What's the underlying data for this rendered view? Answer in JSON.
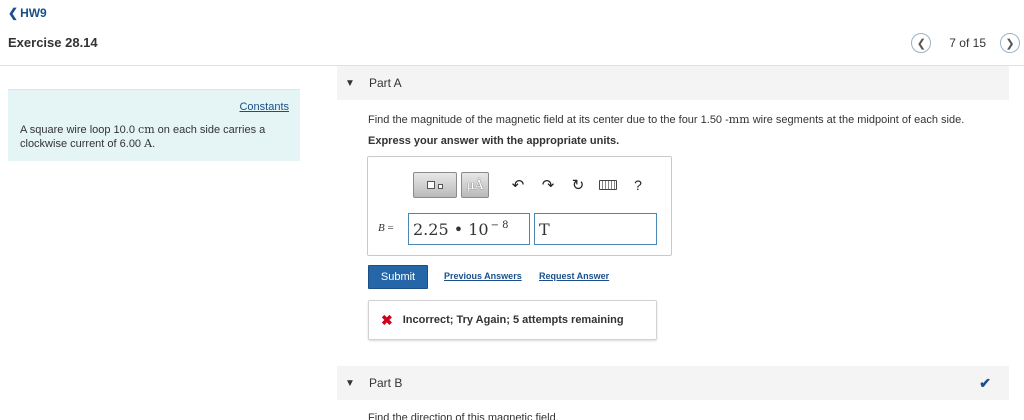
{
  "nav": {
    "back_label": "HW9"
  },
  "exercise": {
    "title": "Exercise 28.14"
  },
  "pager": {
    "text": "7 of 15"
  },
  "problem": {
    "constants_link": "Constants",
    "line1_prefix": "A square wire loop 10.0 ",
    "line1_unit": "cm",
    "line1_suffix": " on each side carries a",
    "line2_prefix": "clockwise current of 6.00 ",
    "line2_unit": "A",
    "line2_suffix": "."
  },
  "part_a": {
    "label": "Part A",
    "question_prefix": "Find the magnitude of the magnetic field at its center due to the four 1.50 -",
    "question_unit": "mm",
    "question_suffix": " wire segments at the midpoint of each side.",
    "instruction": "Express your answer with the appropriate units.",
    "mu_label": "μÅ",
    "help_label": "?",
    "var_name": "B",
    "var_eq": " = ",
    "value_mantissa": "2.25 • 10",
    "value_exponent": "− 8",
    "unit_value": "T",
    "submit_label": "Submit",
    "previous_answers_label": "Previous Answers",
    "request_answer_label": "Request Answer",
    "feedback_message": "Incorrect; Try Again; 5 attempts remaining",
    "feedback_color": "#d0021b"
  },
  "part_b": {
    "label": "Part B",
    "text_partial": "Find the direction of this magnetic field."
  },
  "colors": {
    "accent": "#2566a8",
    "link": "#1a4f8b",
    "problem_bg": "#e5f4f5"
  }
}
